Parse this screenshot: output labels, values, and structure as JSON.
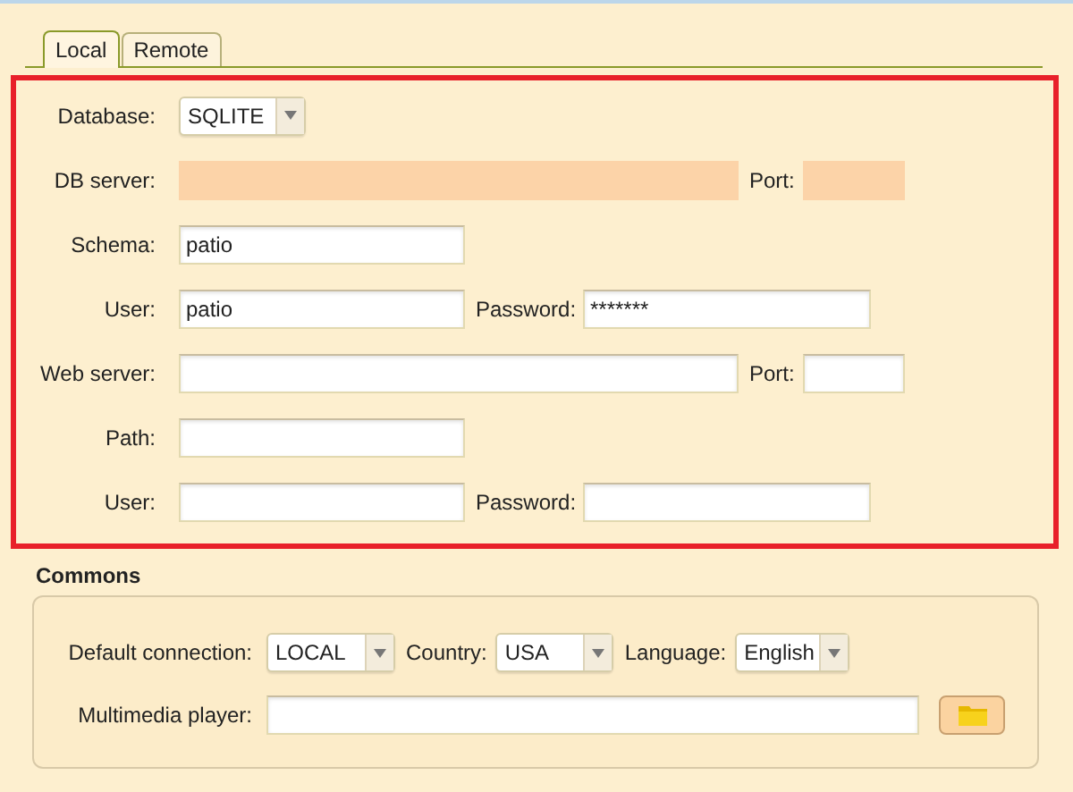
{
  "tabs": [
    {
      "label": "Local",
      "selected": true
    },
    {
      "label": "Remote",
      "selected": false
    }
  ],
  "local": {
    "database": {
      "label": "Database:",
      "value": "SQLITE"
    },
    "db_server": {
      "label": "DB server:",
      "disabled": true
    },
    "db_port": {
      "label": "Port:",
      "disabled": true
    },
    "schema": {
      "label": "Schema:",
      "value": "patio"
    },
    "user": {
      "label": "User:",
      "value": "patio"
    },
    "password": {
      "label": "Password:",
      "value": "*******"
    },
    "web_server": {
      "label": "Web server:"
    },
    "web_port": {
      "label": "Port:"
    },
    "path": {
      "label": "Path:"
    },
    "web_user": {
      "label": "User:"
    },
    "web_password": {
      "label": "Password:"
    }
  },
  "commons": {
    "title": "Commons",
    "default_connection": {
      "label": "Default connection:",
      "value": "LOCAL"
    },
    "country": {
      "label": "Country:",
      "value": "USA"
    },
    "language": {
      "label": "Language:",
      "value": "English"
    },
    "multimedia_player": {
      "label": "Multimedia player:"
    }
  }
}
